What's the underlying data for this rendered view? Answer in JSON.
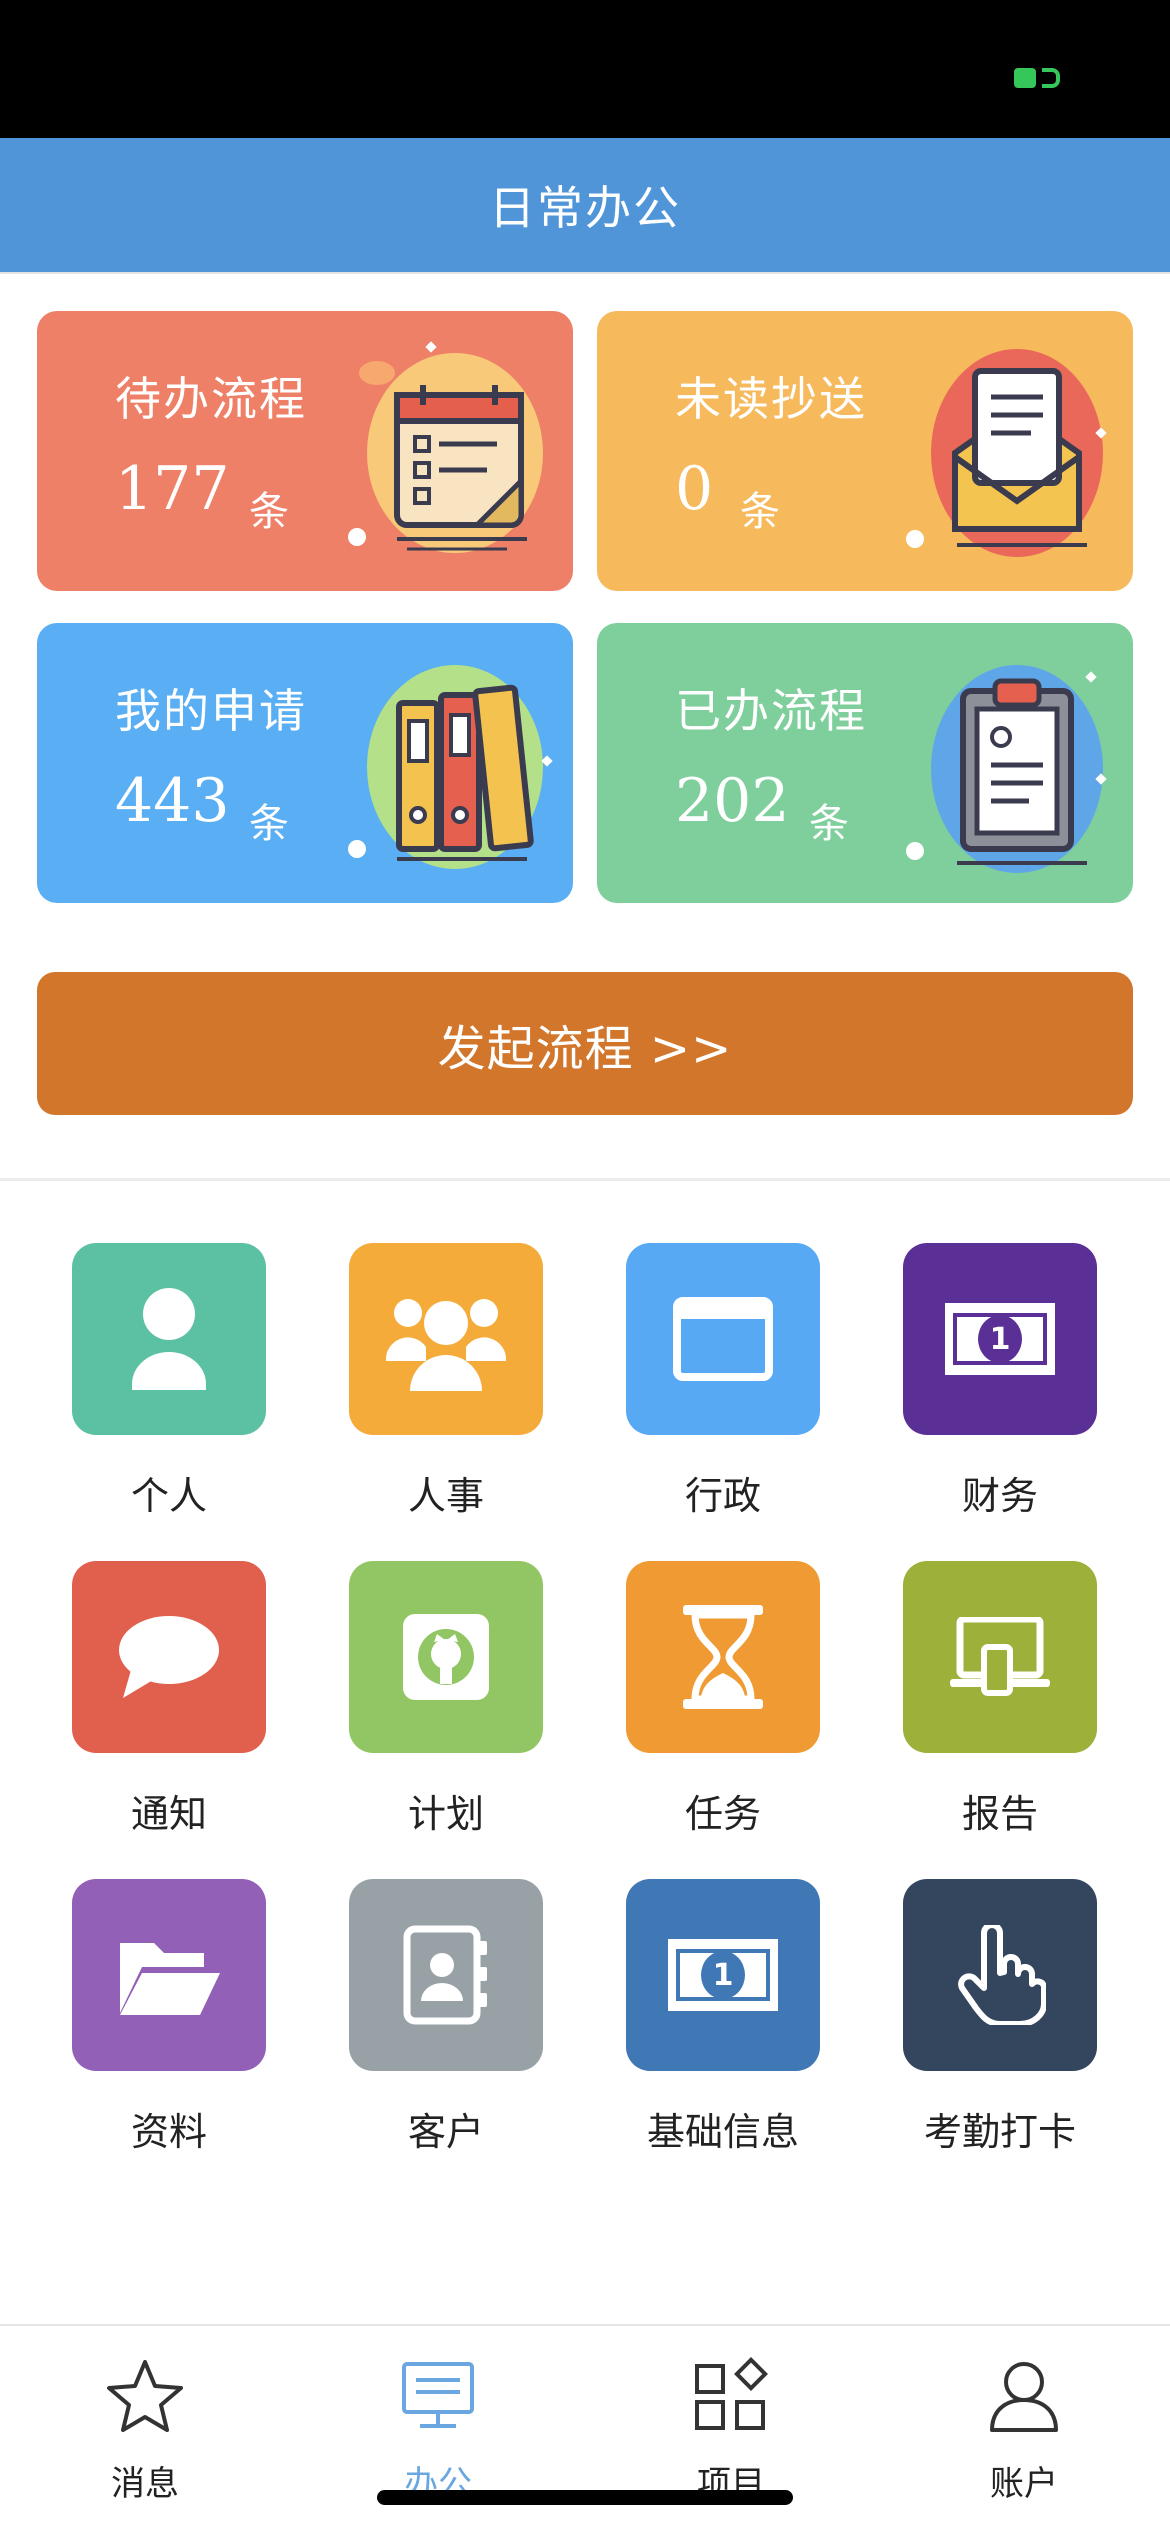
{
  "header": {
    "title": "日常办公"
  },
  "cards": [
    {
      "label": "待办流程",
      "count": "177",
      "unit": "条",
      "color": "#ef8068",
      "icon": "calendar-illustration-icon"
    },
    {
      "label": "未读抄送",
      "count": "0",
      "unit": "条",
      "color": "#f6b95c",
      "icon": "envelope-document-illustration-icon"
    },
    {
      "label": "我的申请",
      "count": "443",
      "unit": "条",
      "color": "#5aaef3",
      "icon": "binders-illustration-icon"
    },
    {
      "label": "已办流程",
      "count": "202",
      "unit": "条",
      "color": "#7fcf9d",
      "icon": "clipboard-illustration-icon"
    }
  ],
  "start_button": {
    "label": "发起流程 >>"
  },
  "modules": [
    {
      "label": "个人",
      "color": "#5cc1a3",
      "icon": "person-icon"
    },
    {
      "label": "人事",
      "color": "#f4ab3a",
      "icon": "group-icon"
    },
    {
      "label": "行政",
      "color": "#57a9f4",
      "icon": "window-icon"
    },
    {
      "label": "财务",
      "color": "#5b3096",
      "icon": "banknote-icon"
    },
    {
      "label": "通知",
      "color": "#e15f4d",
      "icon": "speech-bubble-icon"
    },
    {
      "label": "计划",
      "color": "#92c664",
      "icon": "github-icon"
    },
    {
      "label": "任务",
      "color": "#f09a34",
      "icon": "hourglass-icon"
    },
    {
      "label": "报告",
      "color": "#9db03a",
      "icon": "devices-icon"
    },
    {
      "label": "资料",
      "color": "#9260b6",
      "icon": "folder-open-icon"
    },
    {
      "label": "客户",
      "color": "#98a2a6",
      "icon": "contact-book-icon"
    },
    {
      "label": "基础信息",
      "color": "#3f78b5",
      "icon": "banknote-icon"
    },
    {
      "label": "考勤打卡",
      "color": "#33465d",
      "icon": "pointing-hand-icon"
    }
  ],
  "tabs": [
    {
      "label": "消息",
      "icon": "star-icon",
      "active": false
    },
    {
      "label": "办公",
      "icon": "monitor-icon",
      "active": true
    },
    {
      "label": "项目",
      "icon": "apps-grid-icon",
      "active": false
    },
    {
      "label": "账户",
      "icon": "user-icon",
      "active": false
    }
  ],
  "colors": {
    "header": "#5195d9",
    "accent": "#d2762c",
    "active_tab": "#6aa7e0",
    "status_bar": "#000000"
  }
}
